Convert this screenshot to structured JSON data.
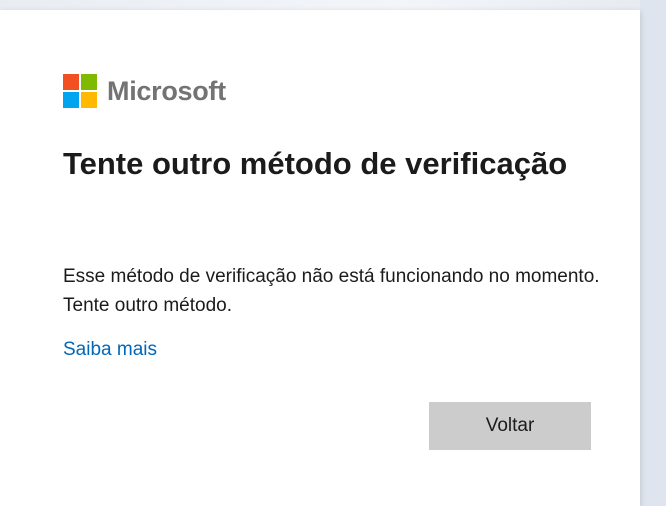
{
  "brand": {
    "name": "Microsoft",
    "logo_colors": [
      "#f25022",
      "#7fba00",
      "#00a4ef",
      "#ffb900"
    ]
  },
  "dialog": {
    "title": "Tente outro método de verificação",
    "description": "Esse método de verificação não está funcionando no momento. Tente outro método.",
    "learn_more_link": "Saiba mais",
    "back_button": "Voltar"
  },
  "colors": {
    "link": "#0067b8",
    "button_bg": "#cccccc",
    "text": "#1b1b1b"
  }
}
